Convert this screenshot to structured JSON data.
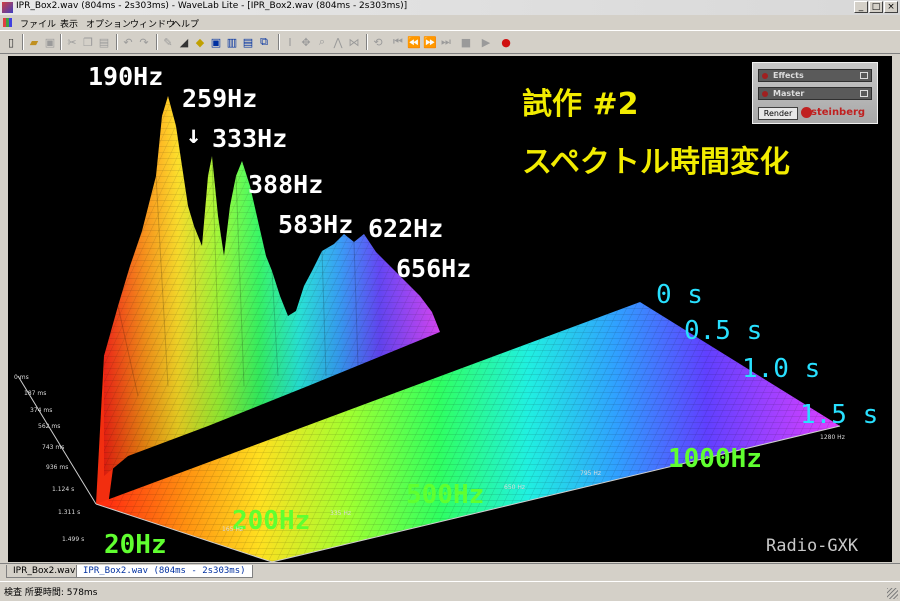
{
  "window": {
    "title": "IPR_Box2.wav (804ms - 2s303ms) - WaveLab Lite - [IPR_Box2.wav (804ms - 2s303ms)]",
    "buttons": [
      "_",
      "□",
      "×"
    ]
  },
  "menu": {
    "items": [
      "ファイル",
      "表示",
      "オプション",
      "ウィンドウ",
      "ヘルプ"
    ]
  },
  "effects_panel": {
    "effects_label": "Effects",
    "master_label": "Master",
    "render_label": "Render",
    "brand": "steinberg"
  },
  "annotations": {
    "peaks": [
      "190Hz",
      "259Hz",
      "333Hz",
      "388Hz",
      "583Hz",
      "622Hz",
      "656Hz"
    ],
    "arrow": "↓",
    "title_line1": "試作 #2",
    "title_line2": "スペクトル時間変化",
    "time_labels": [
      "0 s",
      "0.5 s",
      "1.0 s",
      "1.5 s"
    ],
    "freq_labels": [
      "20Hz",
      "200Hz",
      "500Hz",
      "1000Hz"
    ],
    "signature": "Radio-GXK"
  },
  "axis_ticks": {
    "time": [
      "0 ms",
      "187 ms",
      "374 ms",
      "562 ms",
      "743 ms",
      "936 ms",
      "1.124 s",
      "1.311 s",
      "1.499 s"
    ],
    "freq": [
      "165 Hz",
      "335 Hz",
      "650 Hz",
      "795 Hz",
      "1280 Hz"
    ]
  },
  "tabs": [
    {
      "label": "IPR_Box2.wav",
      "active": false
    },
    {
      "label": "IPR_Box2.wav (804ms - 2s303ms)",
      "active": true
    }
  ],
  "status": {
    "text": "検査 所要時間: 578ms"
  }
}
